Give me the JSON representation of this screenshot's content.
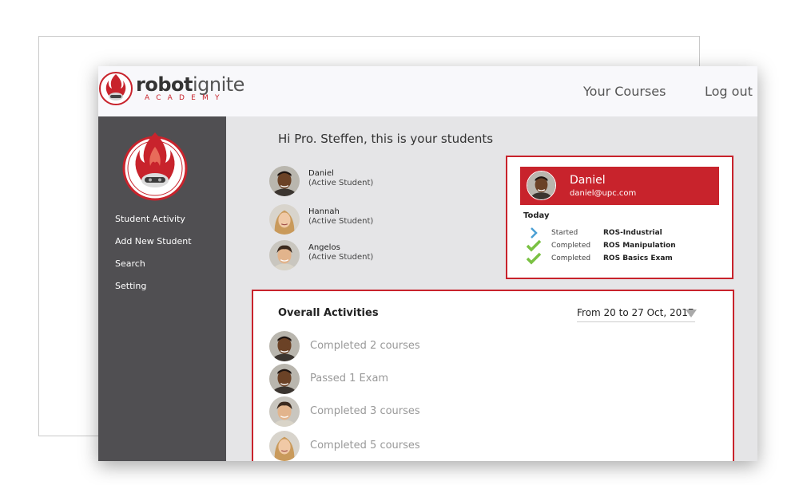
{
  "topbar": {
    "brand_bold": "robot",
    "brand_light": "ignite",
    "brand_sub": "ACADEMY",
    "nav": [
      "Your Courses",
      "Log out"
    ]
  },
  "sidebar": {
    "items": [
      "Student Activity",
      "Add New Student",
      "Search",
      "Setting"
    ]
  },
  "main": {
    "greeting": "Hi  Pro. Steffen, this is your students",
    "students": [
      {
        "name": "Daniel",
        "status": "(Active Student)",
        "avatar": "avatar-daniel"
      },
      {
        "name": "Hannah",
        "status": "(Active Student)",
        "avatar": "avatar-hannah"
      },
      {
        "name": "Angelos",
        "status": "(Active Student)",
        "avatar": "avatar-angelos"
      }
    ]
  },
  "detail": {
    "name": "Daniel",
    "email": "daniel@upc.com",
    "today_label": "Today",
    "activities": [
      {
        "icon": "chevron-right-icon",
        "verb": "Started",
        "item": "ROS-Industrial"
      },
      {
        "icon": "check-icon",
        "verb": "Completed",
        "item": "ROS Manipulation"
      },
      {
        "icon": "check-icon",
        "verb": "Completed",
        "item": "ROS Basics Exam"
      }
    ]
  },
  "overall": {
    "title": "Overall Activities",
    "range": "From 20 to 27 Oct, 2017",
    "items": [
      {
        "text": "Completed 2 courses",
        "avatar": "avatar-daniel"
      },
      {
        "text": "Passed 1 Exam",
        "avatar": "avatar-daniel"
      },
      {
        "text": "Completed 3 courses",
        "avatar": "avatar-angelos"
      },
      {
        "text": "Completed 5 courses",
        "avatar": "avatar-hannah"
      }
    ]
  },
  "colors": {
    "accent": "#c8232c",
    "sidebar": "#504f52",
    "main_bg": "#e5e5e7",
    "check": "#7ac143",
    "chevron": "#4a9fd4"
  }
}
